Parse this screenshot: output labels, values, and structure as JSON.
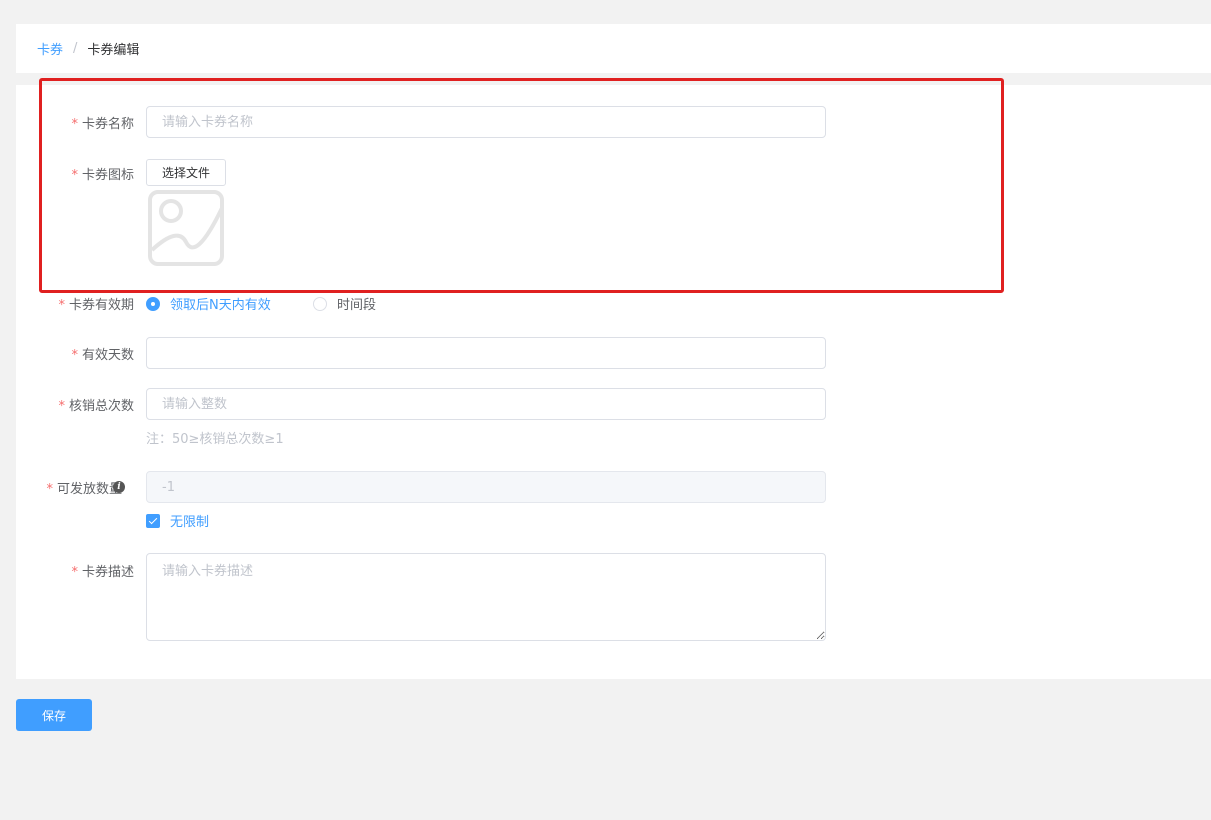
{
  "breadcrumb": {
    "items": [
      {
        "label": "卡券"
      },
      {
        "label": "卡券编辑"
      }
    ],
    "separator": "/"
  },
  "form": {
    "required_mark": "*",
    "name": {
      "label": "卡券名称",
      "placeholder": "请输入卡券名称",
      "value": ""
    },
    "icon": {
      "label": "卡券图标",
      "button_label": "选择文件"
    },
    "validity": {
      "label": "卡券有效期",
      "options": [
        {
          "label": "领取后N天内有效",
          "selected": true
        },
        {
          "label": "时间段",
          "selected": false
        }
      ]
    },
    "valid_days": {
      "label": "有效天数",
      "value": ""
    },
    "redeem_total": {
      "label": "核销总次数",
      "placeholder": "请输入整数",
      "value": "",
      "hint": "注：50≥核销总次数≥1"
    },
    "issue_quantity": {
      "label": "可发放数量",
      "value": "-1",
      "unlimited_label": "无限制",
      "unlimited_checked": true
    },
    "description": {
      "label": "卡券描述",
      "placeholder": "请输入卡券描述",
      "value": ""
    }
  },
  "actions": {
    "save_label": "保存"
  },
  "colors": {
    "primary": "#409eff",
    "required": "#f56c6c",
    "highlight": "#e02020"
  }
}
